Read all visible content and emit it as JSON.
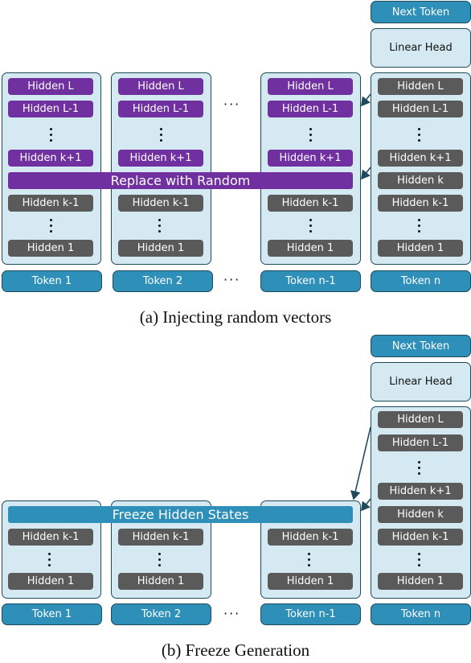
{
  "diagram_a": {
    "caption": "(a) Injecting random vectors",
    "banner": "Replace with Random",
    "next_token": "Next Token",
    "linear_head": "Linear Head",
    "columns": [
      {
        "token": "Token 1",
        "top": [
          "Hidden L",
          "Hidden L-1",
          "Hidden k+1"
        ],
        "bottom": [
          "Hidden k-1",
          "Hidden 1"
        ]
      },
      {
        "token": "Token 2",
        "top": [
          "Hidden L",
          "Hidden L-1",
          "Hidden k+1"
        ],
        "bottom": [
          "Hidden k-1",
          "Hidden 1"
        ]
      },
      {
        "token": "Token n-1",
        "top": [
          "Hidden L",
          "Hidden L-1",
          "Hidden k+1"
        ],
        "bottom": [
          "Hidden k-1",
          "Hidden 1"
        ]
      },
      {
        "token": "Token n",
        "top": [
          "Hidden L",
          "Hidden L-1",
          "Hidden k+1"
        ],
        "k": "Hidden k",
        "bottom": [
          "Hidden k-1",
          "Hidden 1"
        ]
      }
    ],
    "ellipsis": "···"
  },
  "diagram_b": {
    "caption": "(b) Freeze Generation",
    "banner": "Freeze Hidden States",
    "next_token": "Next Token",
    "linear_head": "Linear Head",
    "columns": [
      {
        "token": "Token 1",
        "bottom": [
          "Hidden k-1",
          "Hidden 1"
        ]
      },
      {
        "token": "Token 2",
        "bottom": [
          "Hidden k-1",
          "Hidden 1"
        ]
      },
      {
        "token": "Token n-1",
        "bottom": [
          "Hidden k-1",
          "Hidden 1"
        ]
      },
      {
        "token": "Token n",
        "top": [
          "Hidden L",
          "Hidden L-1",
          "Hidden k+1"
        ],
        "k": "Hidden k",
        "bottom": [
          "Hidden k-1",
          "Hidden 1"
        ]
      }
    ],
    "ellipsis": "···"
  },
  "colors": {
    "purple": "#7030a0",
    "gray": "#5a5a5a",
    "token_blue": "#2e8fb8",
    "column_bg": "#d5e9f2",
    "border": "#1f4a5c"
  }
}
